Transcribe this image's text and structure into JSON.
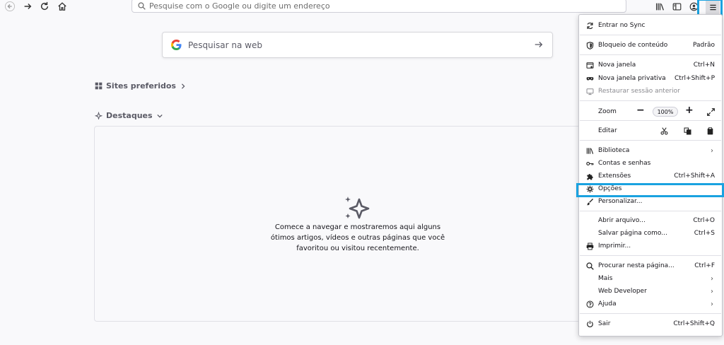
{
  "toolbar": {
    "url_placeholder": "Pesquise com o Google ou digite um endereço"
  },
  "newtab": {
    "search_placeholder": "Pesquisar na web",
    "top_sites_title": "Sites preferidos",
    "highlights_title": "Destaques",
    "highlights_empty": "Comece a navegar e mostraremos aqui alguns ótimos artigos, vídeos e outras páginas que você favoritou ou visitou recentemente."
  },
  "menu": {
    "sync": "Entrar no Sync",
    "content_blocking": "Bloqueio de conteúdo",
    "content_blocking_value": "Padrão",
    "new_window": "Nova janela",
    "new_window_sc": "Ctrl+N",
    "private_window": "Nova janela privativa",
    "private_window_sc": "Ctrl+Shift+P",
    "restore_session": "Restaurar sessão anterior",
    "zoom": "Zoom",
    "zoom_value": "100%",
    "zoom_minus": "−",
    "zoom_plus": "+",
    "edit": "Editar",
    "library": "Biblioteca",
    "logins": "Contas e senhas",
    "addons": "Extensões",
    "addons_sc": "Ctrl+Shift+A",
    "options": "Opções",
    "customize": "Personalizar...",
    "open_file": "Abrir arquivo...",
    "open_file_sc": "Ctrl+O",
    "save_page": "Salvar página como...",
    "save_page_sc": "Ctrl+S",
    "print": "Imprimir...",
    "find": "Procurar nesta página...",
    "find_sc": "Ctrl+F",
    "more": "Mais",
    "web_developer": "Web Developer",
    "help": "Ajuda",
    "quit": "Sair",
    "quit_sc": "Ctrl+Shift+Q",
    "submenu_arrow": "›"
  },
  "colors": {
    "highlight": "#1aa2e0",
    "menu_bg": "#ffffff",
    "page_bg": "#f9f9fb"
  }
}
